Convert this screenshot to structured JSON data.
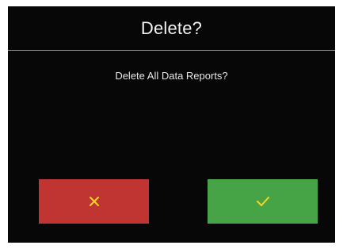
{
  "dialog": {
    "title": "Delete?",
    "message": "Delete All Data Reports?"
  },
  "buttons": {
    "cancel": {
      "icon": "close-icon",
      "color": "#c03531",
      "icon_color": "#f5d623"
    },
    "confirm": {
      "icon": "check-icon",
      "color": "#46a346",
      "icon_color": "#f5d623"
    }
  },
  "colors": {
    "background": "#070707",
    "text": "#ffffff",
    "divider": "#8a8a8a"
  }
}
